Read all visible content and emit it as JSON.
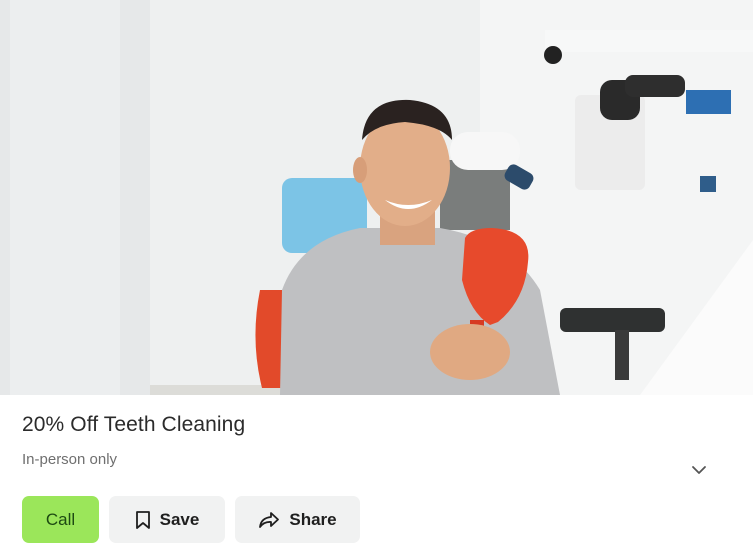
{
  "deal": {
    "title": "20% Off Teeth Cleaning",
    "subtitle": "In-person only"
  },
  "photo": {
    "description_icon": "dentist-patient-photo"
  },
  "actions": {
    "call_label": "Call",
    "save_label": "Save",
    "share_label": "Share"
  },
  "icons": {
    "save": "bookmark-icon",
    "share": "share-arrow-icon",
    "expand": "chevron-down-icon"
  },
  "colors": {
    "call_bg": "#9be65a",
    "call_text": "#1d4a12",
    "secondary_bg": "#f1f2f2",
    "title_text": "#2b2b2b",
    "subtitle_text": "#6f6f6f"
  }
}
